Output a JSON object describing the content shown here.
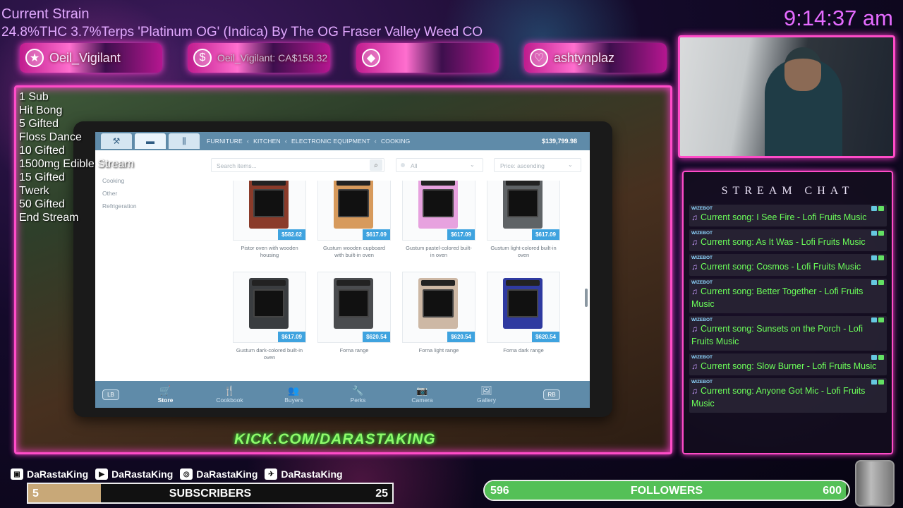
{
  "overlay": {
    "strain_title": "Current Strain",
    "strain_desc": "24.8%THC 3.7%Terps 'Platinum OG' (Indica) By The OG Fraser Valley Weed CO",
    "clock": "9:14:37 am",
    "kick_url": "KICK.COM/DARASTAKING"
  },
  "banners": [
    {
      "icon": "star-icon",
      "glyph": "★",
      "text": "Oeil_Vigilant"
    },
    {
      "icon": "dollar-icon",
      "glyph": "$",
      "text": "Oeil_Vigilant: CA$158.32"
    },
    {
      "icon": "diamond-icon",
      "glyph": "◆",
      "text": ""
    },
    {
      "icon": "heart-icon",
      "glyph": "♡",
      "text": "ashtynplaz"
    }
  ],
  "goals": [
    "1 Sub",
    "Hit Bong",
    "5 Gifted",
    "Floss Dance",
    "10 Gifted",
    "1500mg Edible Stream",
    "15 Gifted",
    "Twerk",
    "50 Gifted",
    "End Stream"
  ],
  "store": {
    "breadcrumbs": [
      "FURNITURE",
      "KITCHEN",
      "ELECTRONIC EQUIPMENT",
      "COOKING"
    ],
    "balance": "$139,799.98",
    "sidebar": [
      "Cooking",
      "Other",
      "Refrigeration"
    ],
    "search_placeholder": "Search items...",
    "filter_value": "All",
    "sort_value": "Price: ascending",
    "items": [
      {
        "name": "Pistor oven with wooden housing",
        "price": "$582.62",
        "color": "#8a3b2a"
      },
      {
        "name": "Gustum wooden cupboard with built-in oven",
        "price": "$617.09",
        "color": "#d79a5c"
      },
      {
        "name": "Gustum pastel-colored built-in oven",
        "price": "$617.09",
        "color": "#e7a2df"
      },
      {
        "name": "Gustum light-colored built-in oven",
        "price": "$617.09",
        "color": "#5f6366"
      },
      {
        "name": "Gustum dark-colored built-in oven",
        "price": "$617.09",
        "color": "#3a3d40"
      },
      {
        "name": "Forna range",
        "price": "$620.54",
        "color": "#4a4c4f"
      },
      {
        "name": "Forna light range",
        "price": "$620.54",
        "color": "#cdb8a5"
      },
      {
        "name": "Forna dark range",
        "price": "$620.54",
        "color": "#2f3aa0"
      }
    ],
    "lb": "LB",
    "rb": "RB",
    "nav": [
      {
        "label": "Store",
        "icon": "cart-icon",
        "glyph": "🛒"
      },
      {
        "label": "Cookbook",
        "icon": "utensils-icon",
        "glyph": "🍴"
      },
      {
        "label": "Buyers",
        "icon": "people-icon",
        "glyph": "👥"
      },
      {
        "label": "Perks",
        "icon": "wrench-icon",
        "glyph": "🔧"
      },
      {
        "label": "Camera",
        "icon": "camera-icon",
        "glyph": "📷"
      },
      {
        "label": "Gallery",
        "icon": "image-icon",
        "glyph": "🖼"
      }
    ]
  },
  "chat": {
    "title": "STREAM CHAT",
    "messages": [
      {
        "user": "WIZEBOT",
        "text": "Current song: I See Fire - Lofi Fruits Music"
      },
      {
        "user": "WIZEBOT",
        "text": "Current song: As It Was - Lofi Fruits Music"
      },
      {
        "user": "WIZEBOT",
        "text": "Current song: Cosmos - Lofi Fruits Music"
      },
      {
        "user": "WIZEBOT",
        "text": "Current song: Better Together - Lofi Fruits Music"
      },
      {
        "user": "WIZEBOT",
        "text": "Current song: Sunsets on the Porch - Lofi Fruits Music"
      },
      {
        "user": "WIZEBOT",
        "text": "Current song: Slow Burner - Lofi Fruits Music"
      },
      {
        "user": "WIZEBOT",
        "text": "Current song: Anyone Got Mic - Lofi Fruits Music"
      }
    ]
  },
  "socials": [
    {
      "icon": "twitch-icon",
      "name": "DaRastaKing"
    },
    {
      "icon": "youtube-icon",
      "name": "DaRastaKing"
    },
    {
      "icon": "instagram-icon",
      "name": "DaRastaKing"
    },
    {
      "icon": "twitter-icon",
      "name": "DaRastaKing"
    }
  ],
  "subs": {
    "label": "SUBSCRIBERS",
    "current": "5",
    "goal": "25",
    "progress": 0.2
  },
  "followers": {
    "label": "FOLLOWERS",
    "current": "596",
    "goal": "600",
    "progress": 0.993
  },
  "colors": {
    "accent_pink": "#ff4cc8",
    "chat_green": "#6cff5a",
    "store_blue": "#5f8ba9",
    "price_blue": "#3fa3df"
  }
}
